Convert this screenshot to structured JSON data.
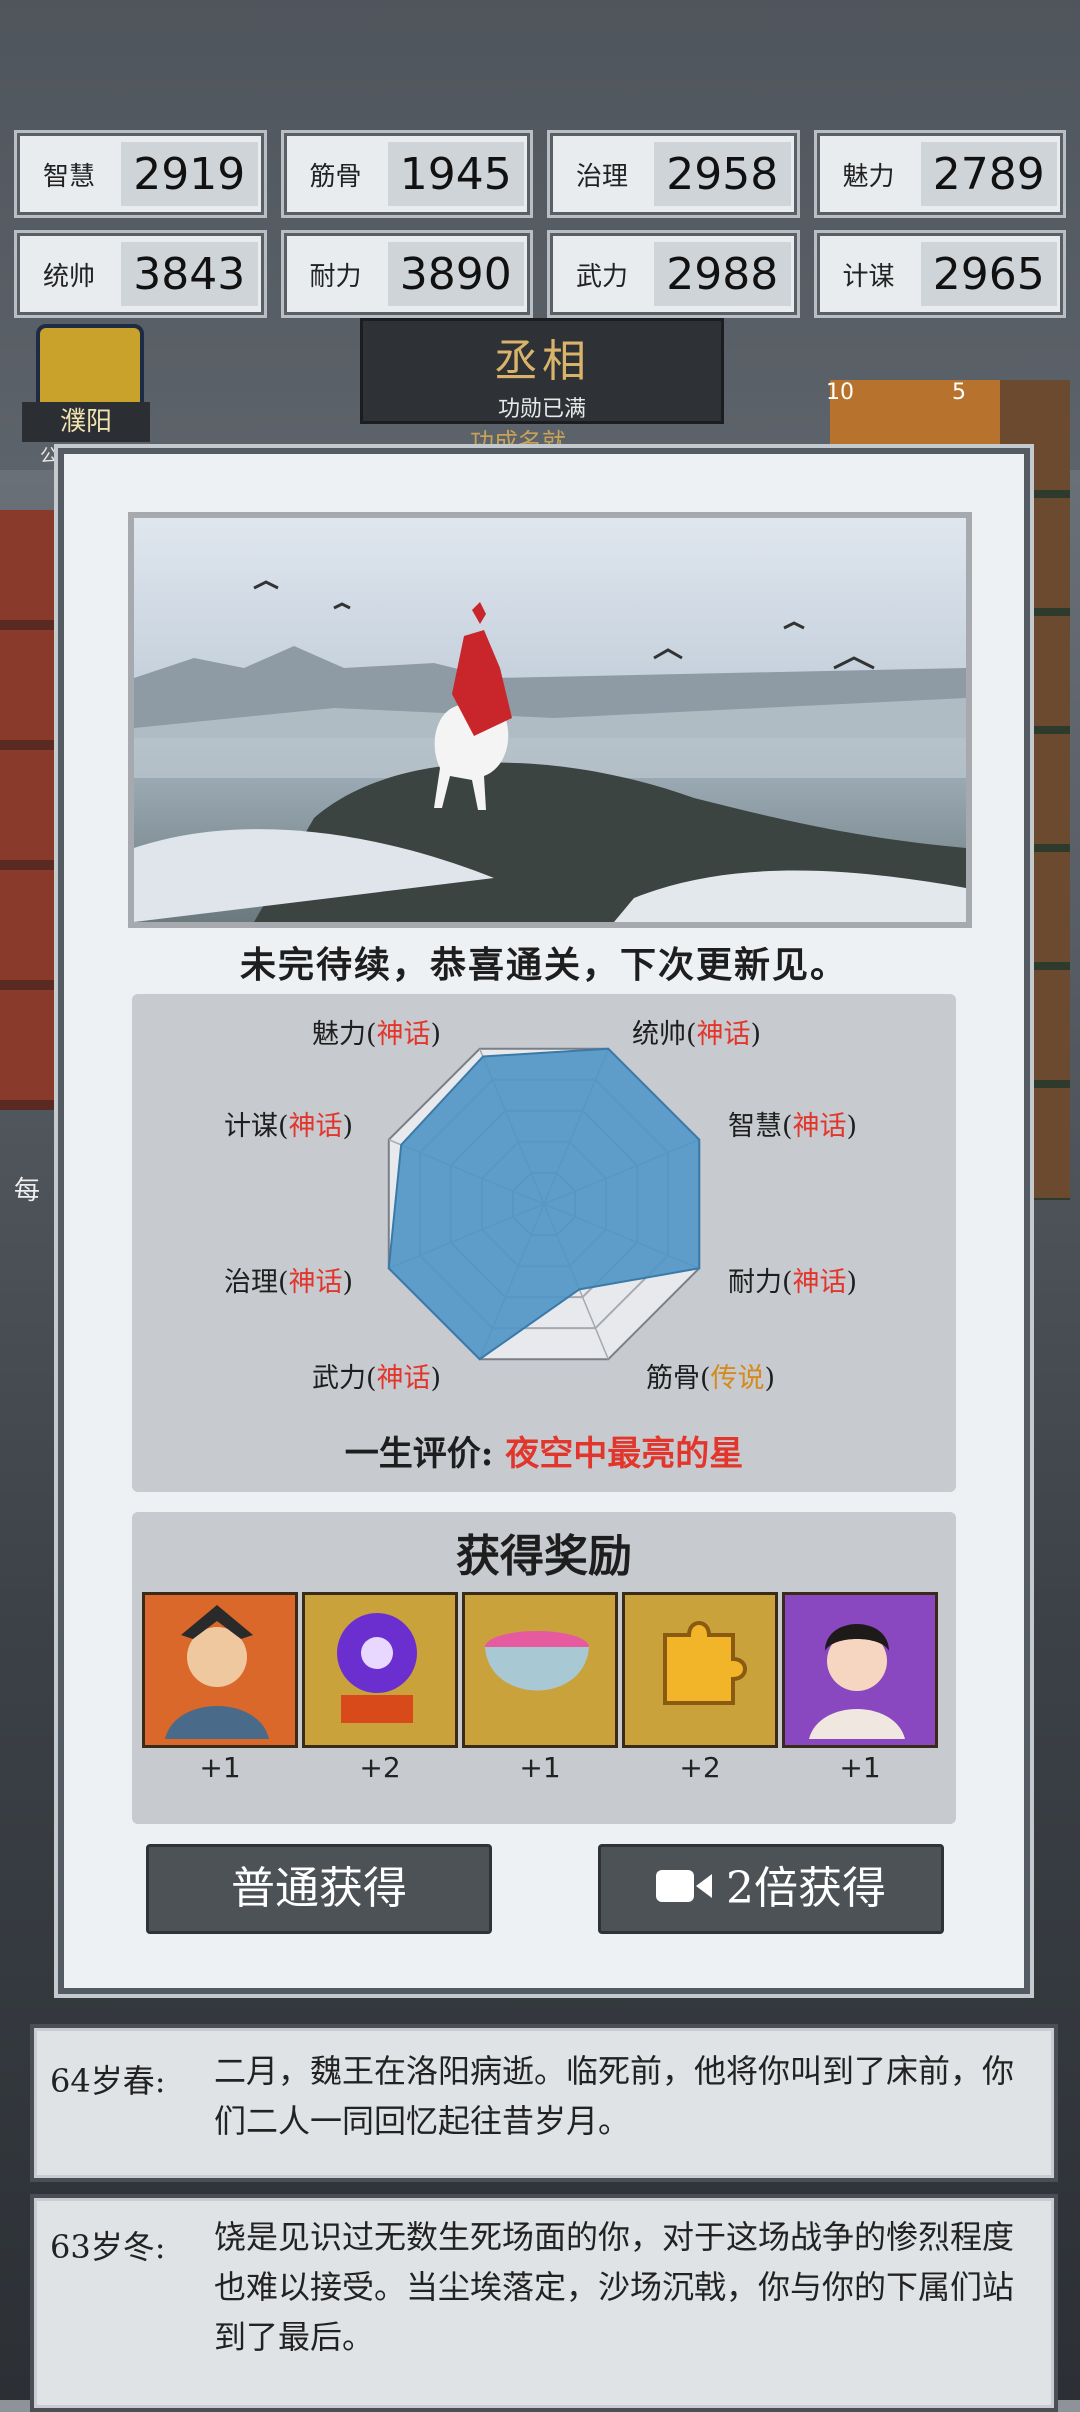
{
  "stats": [
    {
      "label": "智慧",
      "value": "2919"
    },
    {
      "label": "筋骨",
      "value": "1945"
    },
    {
      "label": "治理",
      "value": "2958"
    },
    {
      "label": "魅力",
      "value": "2789"
    },
    {
      "label": "统帅",
      "value": "3843"
    },
    {
      "label": "耐力",
      "value": "3890"
    },
    {
      "label": "武力",
      "value": "2988"
    },
    {
      "label": "计谋",
      "value": "2965"
    }
  ],
  "rank": {
    "title": "丞相",
    "subtitle": "功勋已满",
    "under": "功成名就"
  },
  "crest": {
    "name": "濮阳",
    "sub": "公"
  },
  "side": {
    "num_a": "10",
    "num_b": "5",
    "left_text": "每"
  },
  "modal": {
    "caption": "未完待续，恭喜通关，下次更新见。",
    "radar": {
      "axes": [
        {
          "name": "魅力",
          "grade": "神话"
        },
        {
          "name": "统帅",
          "grade": "神话"
        },
        {
          "name": "智慧",
          "grade": "神话"
        },
        {
          "name": "耐力",
          "grade": "神话"
        },
        {
          "name": "筋骨",
          "grade": "传说"
        },
        {
          "name": "武力",
          "grade": "神话"
        },
        {
          "name": "治理",
          "grade": "神话"
        },
        {
          "name": "计谋",
          "grade": "神话"
        }
      ],
      "verdict_label": "一生评价:",
      "verdict_value": "夜空中最亮的星"
    },
    "rewards_title": "获得奖励",
    "rewards": [
      {
        "icon": "warrior-portrait-icon",
        "count": "+1"
      },
      {
        "icon": "purple-orb-icon",
        "count": "+2"
      },
      {
        "icon": "porcelain-bowl-icon",
        "count": "+1"
      },
      {
        "icon": "puzzle-piece-icon",
        "count": "+2"
      },
      {
        "icon": "lady-portrait-icon",
        "count": "+1"
      }
    ],
    "btn_normal": "普通获得",
    "btn_double": "2倍获得"
  },
  "log": [
    {
      "age": "64岁春:",
      "text": "二月，魏王在洛阳病逝。临死前，他将你叫到了床前，你们二人一同回忆起往昔岁月。"
    },
    {
      "age": "63岁冬:",
      "text": "饶是见识过无数生死场面的你，对于这场战争的惨烈程度也难以接受。当尘埃落定，沙场沉戟，你与你的下属们站到了最后。"
    }
  ]
}
